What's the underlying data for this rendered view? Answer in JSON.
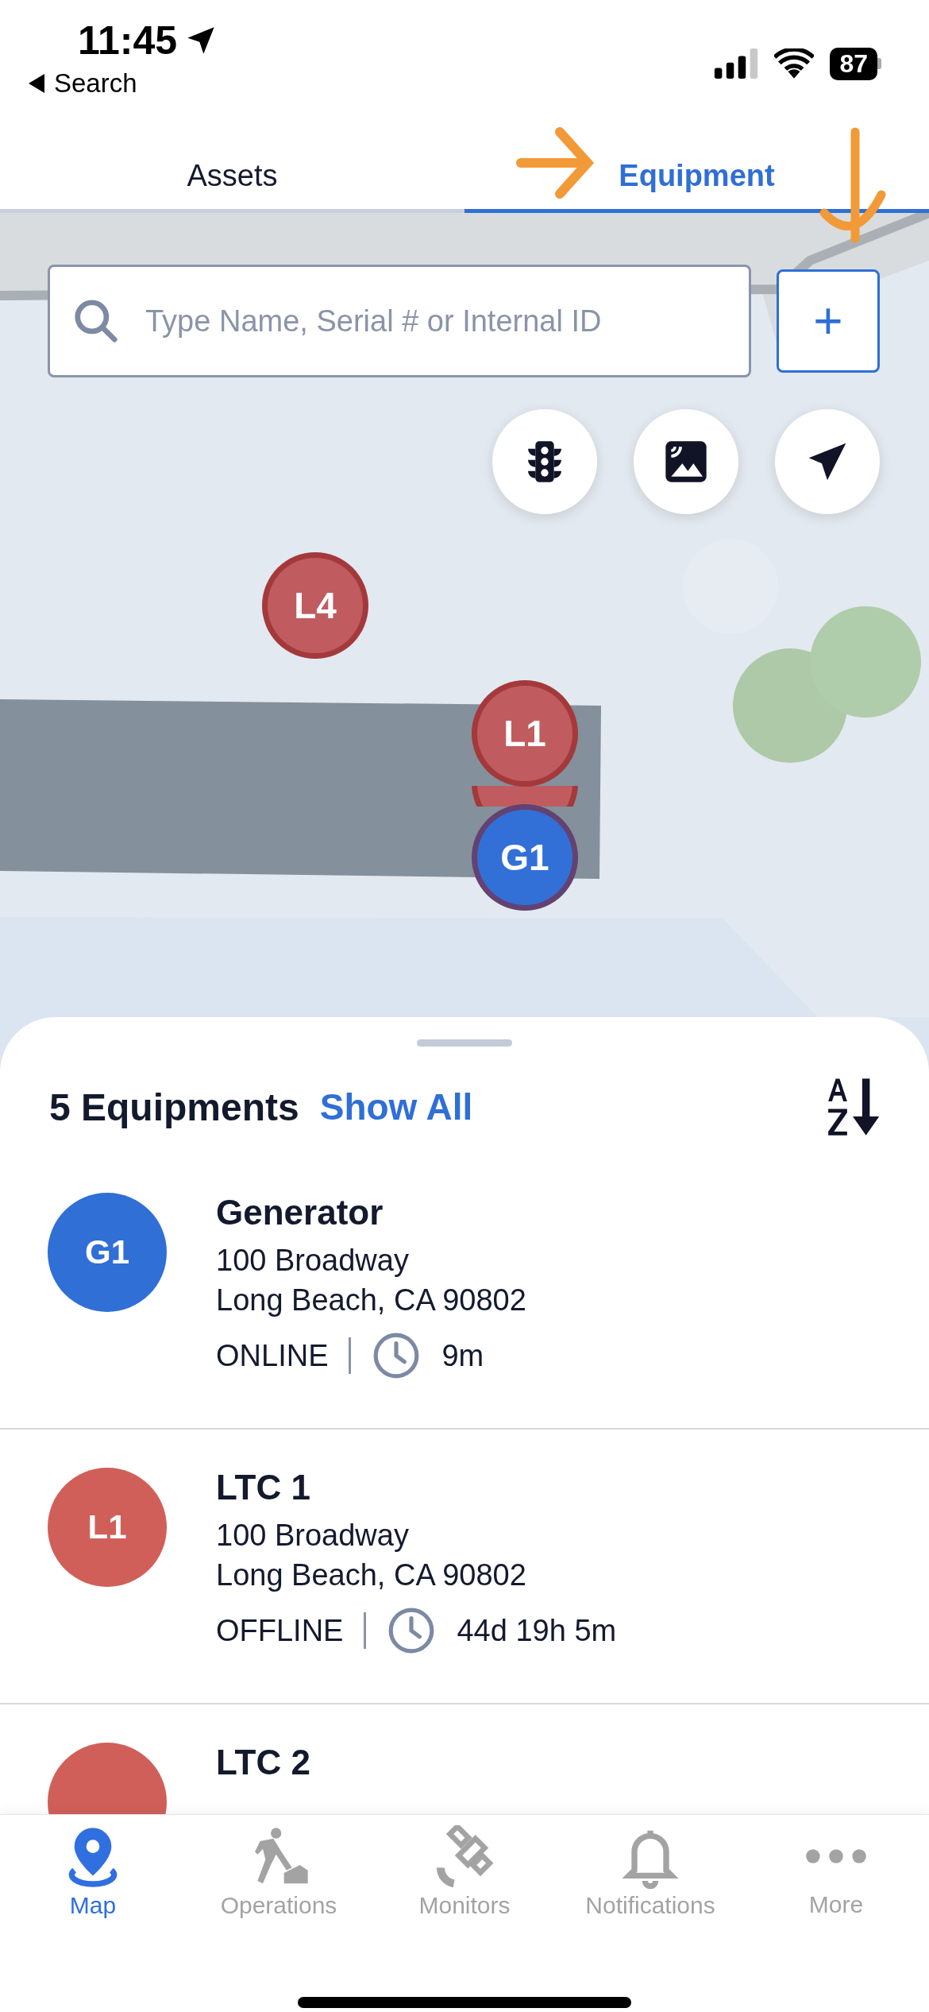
{
  "status_bar": {
    "time": "11:45",
    "back_label": "Search",
    "battery": "87"
  },
  "tabs": [
    {
      "label": "Assets",
      "selected": false
    },
    {
      "label": "Equipment",
      "selected": true
    }
  ],
  "search": {
    "placeholder": "Type Name, Serial # or Internal ID",
    "add_button": "+"
  },
  "map": {
    "kind": "picture",
    "markers": [
      {
        "label": "L4",
        "color": "#c05c60"
      },
      {
        "color": "#c05c60"
      },
      {
        "label": "L1",
        "color": "#c05c60"
      },
      {
        "label": "G1",
        "color": "#3270d8"
      }
    ]
  },
  "sheet": {
    "count": "5 Equipments",
    "show_all": "Show All",
    "items": [
      {
        "initials": "G1",
        "color": "#2f6fd6",
        "name": "Generator",
        "address": [
          "100 Broadway",
          "Long Beach, CA 90802"
        ],
        "status": "ONLINE",
        "elapsed": "9m"
      },
      {
        "initials": "L1",
        "color": "#d15f59",
        "name": "LTC 1",
        "address": [
          "100 Broadway",
          "Long Beach, CA 90802"
        ],
        "status": "OFFLINE",
        "elapsed": "44d 19h 5m"
      },
      {
        "color": "#d15f59",
        "name": "LTC 2"
      }
    ]
  },
  "tab_bar": [
    {
      "kind": "map",
      "label": "Map",
      "selected": true
    },
    {
      "kind": "operations",
      "label": "Operations",
      "selected": false
    },
    {
      "kind": "monitors",
      "label": "Monitors",
      "selected": false
    },
    {
      "kind": "notifications",
      "label": "Notifications",
      "selected": false
    },
    {
      "kind": "more",
      "label": "More",
      "selected": false
    }
  ]
}
